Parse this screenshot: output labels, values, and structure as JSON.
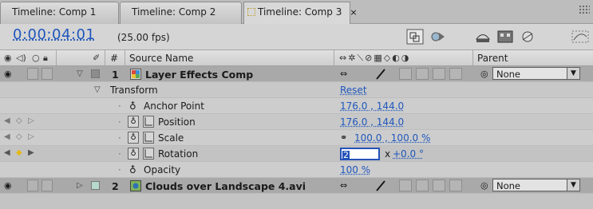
{
  "tabs": [
    {
      "label": "Timeline: Comp 1"
    },
    {
      "label": "Timeline: Comp 2"
    },
    {
      "label": "Timeline: Comp 3",
      "close": "×"
    }
  ],
  "header": {
    "timecode": "0:00:04:01",
    "fps": "(25.00 fps)"
  },
  "columns": {
    "hash": "#",
    "source_name": "Source Name",
    "parent": "Parent"
  },
  "layers": [
    {
      "number": "1",
      "name": "Layer Effects Comp",
      "parent": "None",
      "label_color": "#8c8c8c"
    },
    {
      "number": "2",
      "name": "Clouds over Landscape 4.avi",
      "parent": "None",
      "label_color": "#b7d9cc"
    }
  ],
  "transform": {
    "label": "Transform",
    "reset": "Reset",
    "properties": [
      {
        "name": "Anchor Point",
        "value": "176.0 , 144.0"
      },
      {
        "name": "Position",
        "value": "176.0 , 144.0"
      },
      {
        "name": "Scale",
        "value": "100.0 , 100.0 %"
      },
      {
        "name": "Rotation",
        "edit_value": "2",
        "value": "+0.0 °",
        "prefix": "x"
      },
      {
        "name": "Opacity",
        "value": "100 %"
      }
    ]
  },
  "colors": {
    "accent": "#1f57bc",
    "layer_row": "#a9a9a9",
    "panel": "#c8c8c8"
  }
}
